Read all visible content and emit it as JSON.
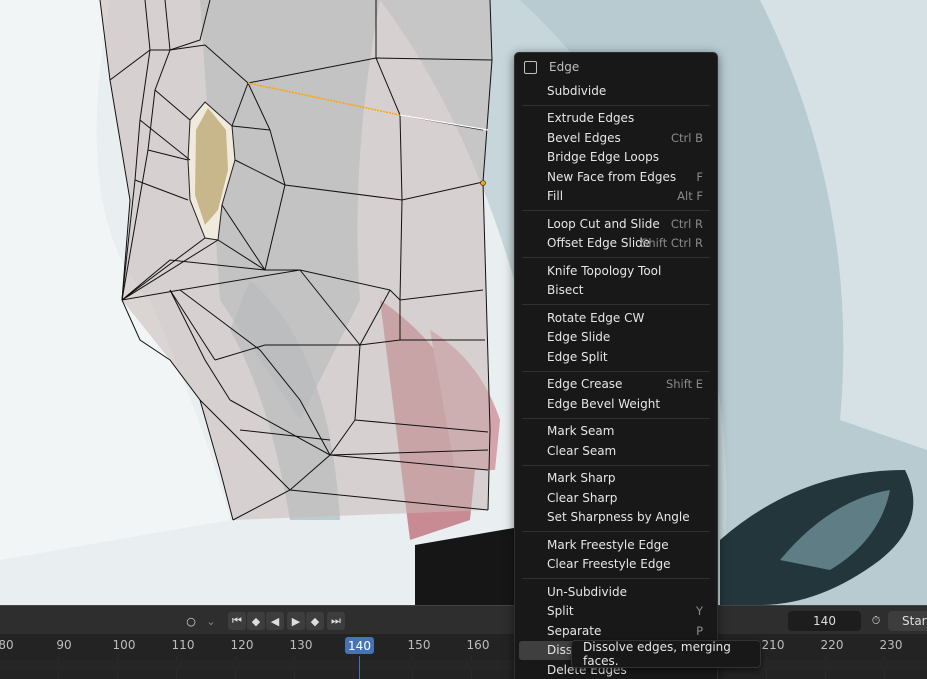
{
  "context_menu": {
    "title": "Edge",
    "items": [
      {
        "label": "Subdivide",
        "shortcut": ""
      },
      {
        "sep": true
      },
      {
        "label": "Extrude Edges",
        "shortcut": ""
      },
      {
        "label": "Bevel Edges",
        "shortcut": "Ctrl B"
      },
      {
        "label": "Bridge Edge Loops",
        "shortcut": ""
      },
      {
        "label": "New Face from Edges",
        "shortcut": "F"
      },
      {
        "label": "Fill",
        "shortcut": "Alt F"
      },
      {
        "sep": true
      },
      {
        "label": "Loop Cut and Slide",
        "shortcut": "Ctrl R"
      },
      {
        "label": "Offset Edge Slide",
        "shortcut": "Shift Ctrl R"
      },
      {
        "sep": true
      },
      {
        "label": "Knife Topology Tool",
        "shortcut": ""
      },
      {
        "label": "Bisect",
        "shortcut": ""
      },
      {
        "sep": true
      },
      {
        "label": "Rotate Edge CW",
        "shortcut": ""
      },
      {
        "label": "Edge Slide",
        "shortcut": ""
      },
      {
        "label": "Edge Split",
        "shortcut": ""
      },
      {
        "sep": true
      },
      {
        "label": "Edge Crease",
        "shortcut": "Shift E"
      },
      {
        "label": "Edge Bevel Weight",
        "shortcut": ""
      },
      {
        "sep": true
      },
      {
        "label": "Mark Seam",
        "shortcut": ""
      },
      {
        "label": "Clear Seam",
        "shortcut": ""
      },
      {
        "sep": true
      },
      {
        "label": "Mark Sharp",
        "shortcut": ""
      },
      {
        "label": "Clear Sharp",
        "shortcut": ""
      },
      {
        "label": "Set Sharpness by Angle",
        "shortcut": ""
      },
      {
        "sep": true
      },
      {
        "label": "Mark Freestyle Edge",
        "shortcut": ""
      },
      {
        "label": "Clear Freestyle Edge",
        "shortcut": ""
      },
      {
        "sep": true
      },
      {
        "label": "Un-Subdivide",
        "shortcut": ""
      },
      {
        "label": "Split",
        "shortcut": "Y"
      },
      {
        "label": "Separate",
        "shortcut": "P"
      },
      {
        "label": "Diss",
        "shortcut": "",
        "highlighted": true
      },
      {
        "label": "Delete Edges",
        "shortcut": ""
      }
    ]
  },
  "tooltip": "Dissolve edges, merging faces.",
  "timeline": {
    "current_frame": "140",
    "frame_field": "140",
    "start_label": "Start",
    "ticks": [
      "80",
      "90",
      "100",
      "110",
      "120",
      "130",
      "140",
      "150",
      "160",
      "210",
      "220",
      "230"
    ]
  },
  "colors": {
    "accent": "#4772b3",
    "menu_bg": "#181818",
    "selected_edge": "#ffa500"
  }
}
